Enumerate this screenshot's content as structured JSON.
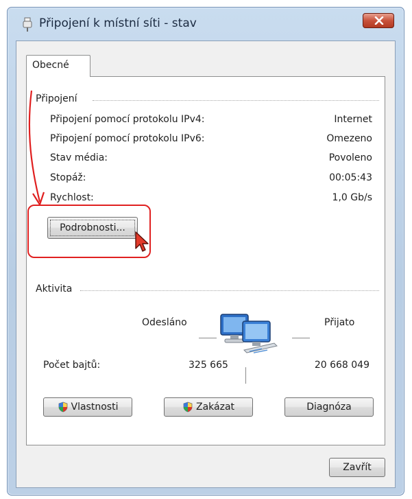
{
  "window": {
    "title": "Připojení k místní síti - stav",
    "close_label": "×"
  },
  "tabs": [
    {
      "label": "Obecné"
    }
  ],
  "connection": {
    "title": "Připojení",
    "rows": [
      {
        "label": "Připojení pomocí protokolu IPv4:",
        "value": "Internet"
      },
      {
        "label": "Připojení pomocí protokolu IPv6:",
        "value": "Omezeno"
      },
      {
        "label": "Stav média:",
        "value": "Povoleno"
      },
      {
        "label": "Stopáž:",
        "value": "00:05:43"
      },
      {
        "label": "Rychlost:",
        "value": "1,0 Gb/s"
      }
    ],
    "details_button": "Podrobnosti..."
  },
  "activity": {
    "title": "Aktivita",
    "sent_label": "Odesláno",
    "received_label": "Přijato",
    "bytes_label": "Počet bajtů:",
    "bytes_sent": "325 665",
    "bytes_received": "20 668 049"
  },
  "buttons": {
    "properties": "Vlastnosti",
    "disable": "Zakázat",
    "diagnose": "Diagnóza",
    "close": "Zavřít"
  },
  "colors": {
    "annotation": "#e02020",
    "titlebar": "#c9dcef",
    "close_button": "#c8523b"
  },
  "icons": {
    "title": "network-adapter-icon",
    "activity": "network-computers-icon",
    "shield": "uac-shield-icon",
    "cursor": "mouse-cursor-icon"
  }
}
